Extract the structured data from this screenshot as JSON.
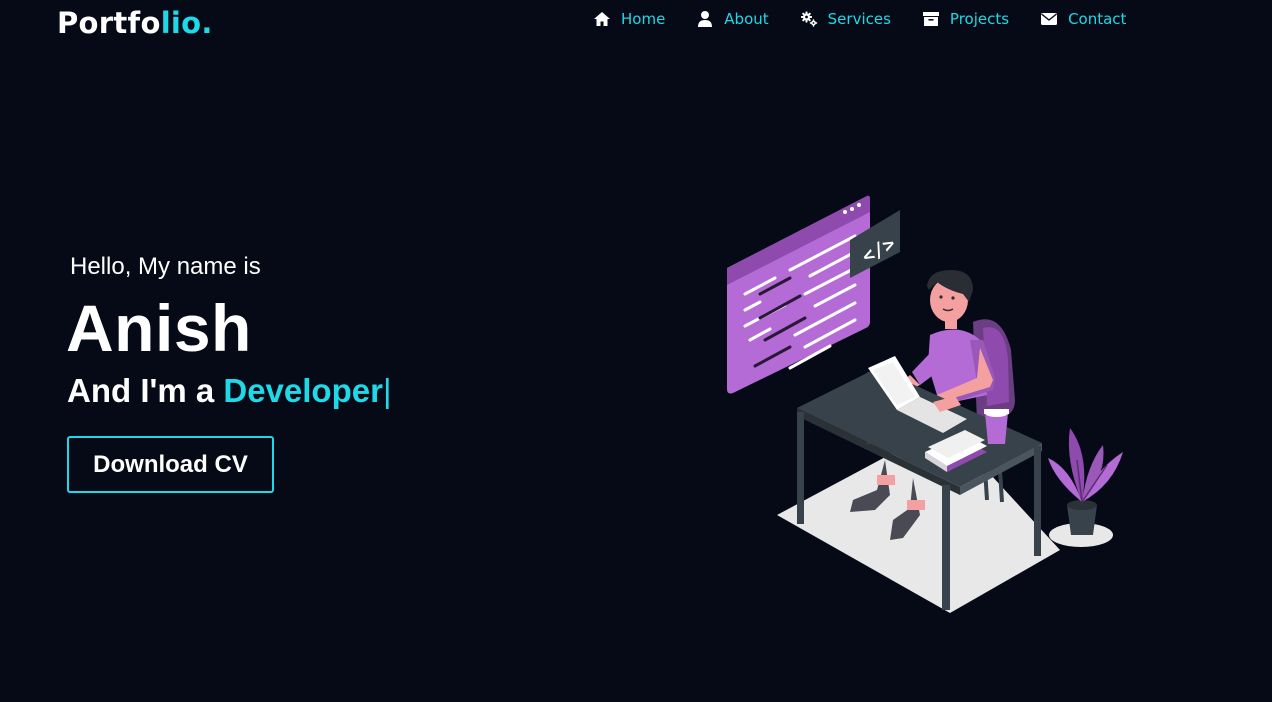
{
  "header": {
    "logo_main": "Portfo",
    "logo_accent": "lio.",
    "nav": [
      {
        "label": "Home",
        "icon": "home-icon"
      },
      {
        "label": "About",
        "icon": "user-icon"
      },
      {
        "label": "Services",
        "icon": "gears-icon"
      },
      {
        "label": "Projects",
        "icon": "archive-icon"
      },
      {
        "label": "Contact",
        "icon": "envelope-icon"
      }
    ]
  },
  "hero": {
    "greeting": "Hello, My name is",
    "name": "Anish",
    "role_prefix": "And I'm a",
    "role_typed": "Developer",
    "cursor": "|",
    "cta_label": "Download CV"
  },
  "illustration": {
    "code_tag": "</>"
  },
  "colors": {
    "background": "#050a16",
    "accent": "#1ed9e8",
    "text": "#ffffff",
    "illustration_purple": "#b56bd6",
    "illustration_dark": "#37424a"
  }
}
